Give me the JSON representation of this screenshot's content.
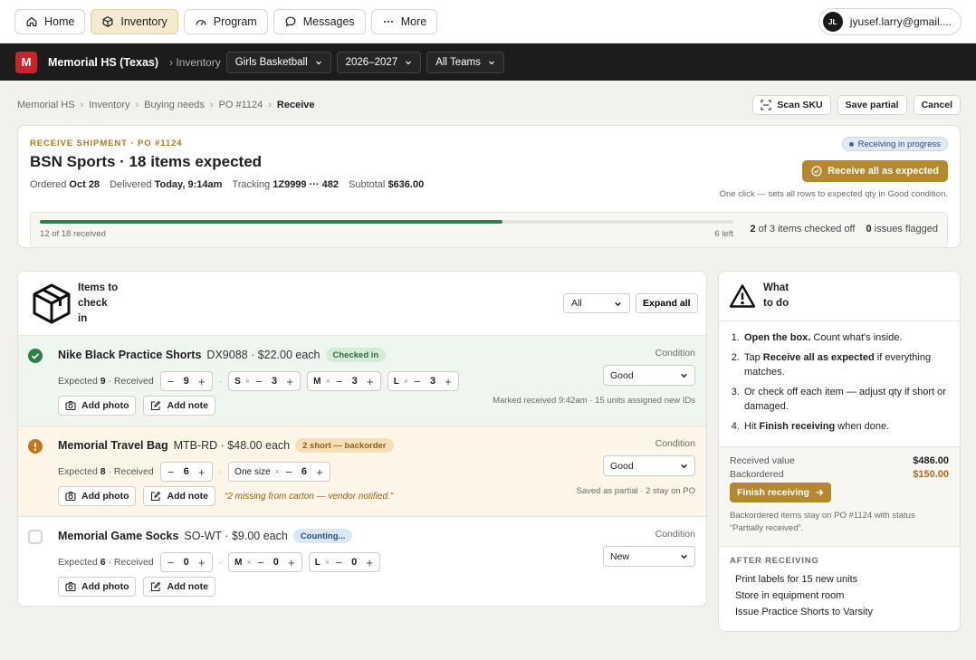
{
  "nav": {
    "items": [
      {
        "label": "Home",
        "icon": "home-icon"
      },
      {
        "label": "Inventory",
        "icon": "box-icon",
        "active": true
      },
      {
        "label": "Program",
        "icon": "gauge-icon"
      },
      {
        "label": "Messages",
        "icon": "chat-icon"
      },
      {
        "label": "More",
        "icon": "more-icon"
      }
    ],
    "account": {
      "initials": "JL",
      "email": "jyusef.larry@gmail...."
    }
  },
  "org": {
    "logo_letter": "M",
    "name": "Memorial HS (Texas)",
    "section": "› Inventory",
    "selectors": [
      "Girls Basketball",
      "2026–2027",
      "All Teams"
    ]
  },
  "breadcrumb": {
    "items": [
      "Memorial HS",
      "Inventory",
      "Buying needs",
      "PO #1124"
    ],
    "current": "Receive"
  },
  "actions": {
    "scan": "Scan SKU",
    "save": "Save partial",
    "cancel": "Cancel"
  },
  "shipment": {
    "eyebrow": "RECEIVE SHIPMENT · PO #1124",
    "title": "BSN Sports · 18 items expected",
    "ordered_label": "Ordered",
    "ordered": "Oct 28",
    "delivered_label": "Delivered",
    "delivered": "Today, 9:14am",
    "tracking_label": "Tracking",
    "tracking": "1Z9999 ··· 482",
    "subtotal_label": "Subtotal",
    "subtotal": "$636.00",
    "status": "Receiving in progress",
    "primary": "Receive all as expected",
    "hint": "One click — sets all rows to expected qty in Good condition.",
    "progress_fraction": 0.667,
    "progress_left": "12 of 18 received",
    "progress_right": "6 left",
    "checked_count": "2",
    "checked_text": "of 3 items checked off",
    "issues_count": "0",
    "issues_text": "issues flagged"
  },
  "items_panel": {
    "title_lines": [
      "Items to",
      "check",
      "in"
    ],
    "filter": "All",
    "expand": "Expand all",
    "condition_label": "Condition",
    "add_photo": "Add photo",
    "add_note": "Add note",
    "expected_label": "Expected",
    "received_label": "Received",
    "rows": [
      {
        "name": "Nike Black Practice Shorts",
        "sku": "DX9088 · $22.00 each",
        "badge": "Checked in",
        "expected": "9",
        "received": "9",
        "sizes": [
          {
            "label": "S",
            "qty": "3"
          },
          {
            "label": "M",
            "qty": "3"
          },
          {
            "label": "L",
            "qty": "3"
          }
        ],
        "condition": "Good",
        "note": "Marked received 9:42am · 15 units assigned new IDs"
      },
      {
        "name": "Memorial Travel Bag",
        "sku": "MTB-RD · $48.00 each",
        "badge": "2 short — backorder",
        "expected": "8",
        "received": "6",
        "sizes": [
          {
            "label": "One size",
            "qty": "6"
          }
        ],
        "condition": "Good",
        "italic_note": "“2 missing from carton — vendor notified.”",
        "note": "Saved as partial · 2 stay on PO"
      },
      {
        "name": "Memorial Game Socks",
        "sku": "SO-WT · $9.00 each",
        "badge": "Counting...",
        "expected": "6",
        "received": "0",
        "sizes": [
          {
            "label": "M",
            "qty": "0"
          },
          {
            "label": "L",
            "qty": "0"
          }
        ],
        "condition": "New"
      }
    ]
  },
  "todo": {
    "title_lines": [
      "What",
      "to do"
    ],
    "steps": [
      {
        "bold": "Open the box.",
        "text": " Count what's inside."
      },
      {
        "pre": "Tap ",
        "bold": "Receive all as expected",
        "text": " if everything matches."
      },
      {
        "pre": "Or check off each item — adjust qty if short or damaged.",
        "bold": "",
        "text": ""
      },
      {
        "pre": "Hit ",
        "bold": "Finish receiving",
        "text": " when done."
      }
    ],
    "received_value_label": "Received value",
    "received_value": "$486.00",
    "backordered_label": "Backordered",
    "backordered": "$150.00",
    "finish": "Finish receiving",
    "finish_note": "Backordered items stay on PO #1124 with status “Partially received”.",
    "after_heading": "AFTER RECEIVING",
    "after_items": [
      "Print labels for 15 new units",
      "Store in equipment room",
      "Issue Practice Shorts to Varsity"
    ]
  }
}
